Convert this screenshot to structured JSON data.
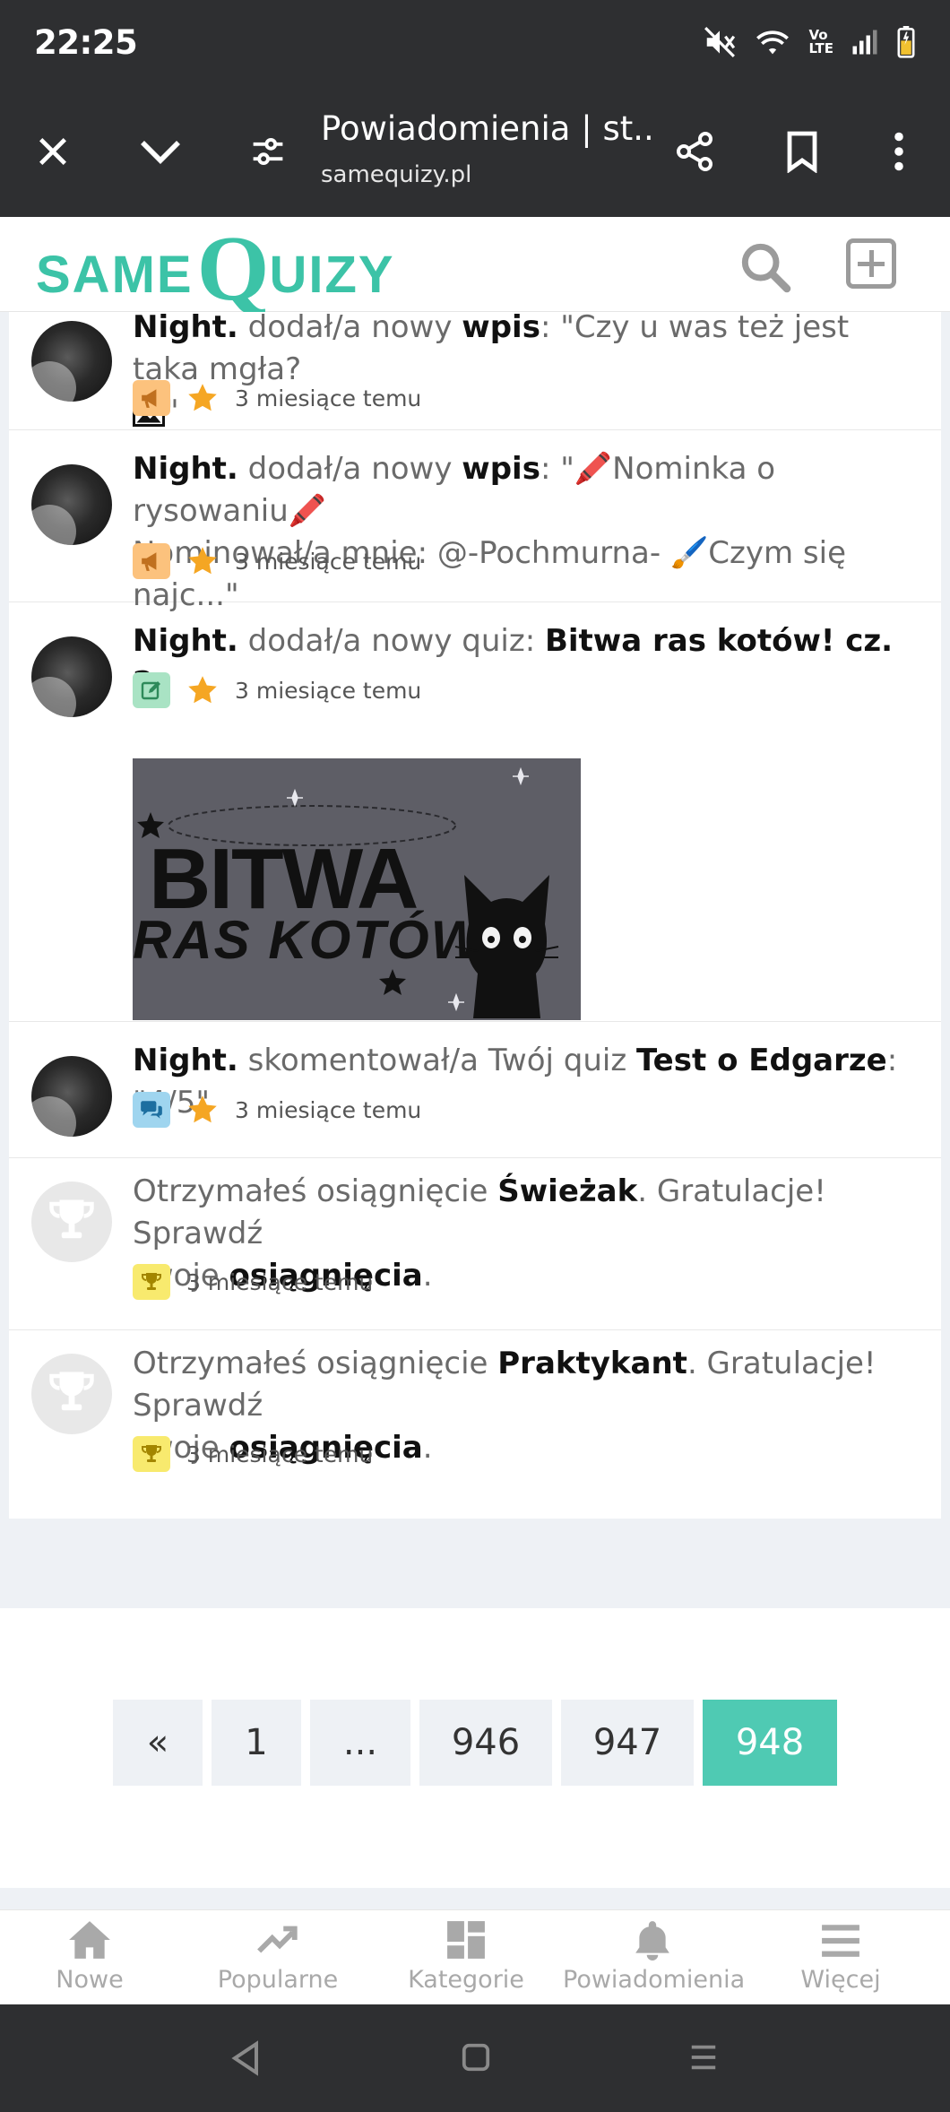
{
  "status_bar": {
    "time": "22:25",
    "icons": [
      "mute-icon",
      "wifi-icon",
      "volte-icon",
      "signal-icon",
      "battery-icon"
    ],
    "volte_top": "Vo",
    "volte_bottom": "LTE"
  },
  "browser": {
    "title": "Powiadomienia | st...",
    "url": "samequizy.pl",
    "buttons": [
      "close-icon",
      "chevron-down-icon",
      "tune-icon",
      "share-icon",
      "bookmark-icon",
      "more-icon"
    ]
  },
  "site": {
    "logo_same": "SAME",
    "logo_q": "Q",
    "logo_uizy": "UIZY",
    "accent_color": "#3cc3a7"
  },
  "notifications": [
    {
      "user": "Night.",
      "action": "dodał/a nowy",
      "object": "wpis",
      "content": ": \"Czy u was też jest taka mgła?",
      "content_end": "\"",
      "time": "3 miesiące temu",
      "badge_icon": "megaphone-icon"
    },
    {
      "user": "Night.",
      "action": "dodał/a nowy",
      "object": "wpis",
      "content_line1": ": \"🖍️Nominka o rysowaniu🖍️",
      "content_line2": "Nominował/a mnie: @-Pochmurna- 🖌️Czym się najc...\"",
      "time": "3 miesiące temu",
      "badge_icon": "megaphone-icon"
    },
    {
      "user": "Night.",
      "action": "dodał/a nowy quiz:",
      "object": "Bitwa ras kotów! cz. 2",
      "time": "3 miesiące temu",
      "badge_icon": "edit-icon",
      "image_text_1": "BITWA",
      "image_text_2": "RAS KOTÓW"
    },
    {
      "user": "Night.",
      "action": "skomentował/a Twój quiz",
      "object": "Test o Edgarze",
      "content": ": \"4/5\"",
      "time": "3 miesiące temu",
      "badge_icon": "comment-icon"
    },
    {
      "prefix": "Otrzymałeś osiągnięcie",
      "achievement": "Świeżak",
      "suffix": ". Gratulacje! Sprawdź",
      "line2_prefix": "swoje",
      "link": "osiągnięcia",
      "line2_suffix": ".",
      "time": "3 miesiące temu",
      "badge_icon": "trophy-icon"
    },
    {
      "prefix": "Otrzymałeś osiągnięcie",
      "achievement": "Praktykant",
      "suffix": ". Gratulacje! Sprawdź",
      "line2_prefix": "swoje",
      "link": "osiągnięcia",
      "line2_suffix": ".",
      "time": "3 miesiące temu",
      "badge_icon": "trophy-icon"
    }
  ],
  "pagination": {
    "prev": "«",
    "pages": [
      "1",
      "...",
      "946",
      "947",
      "948"
    ],
    "current": "948",
    "active_color": "#4fcab3"
  },
  "bottom_nav": [
    {
      "label": "Nowe",
      "icon": "home-icon"
    },
    {
      "label": "Popularne",
      "icon": "trending-icon"
    },
    {
      "label": "Kategorie",
      "icon": "dashboard-icon"
    },
    {
      "label": "Powiadomienia",
      "icon": "bell-icon"
    },
    {
      "label": "Więcej",
      "icon": "menu-icon"
    }
  ]
}
